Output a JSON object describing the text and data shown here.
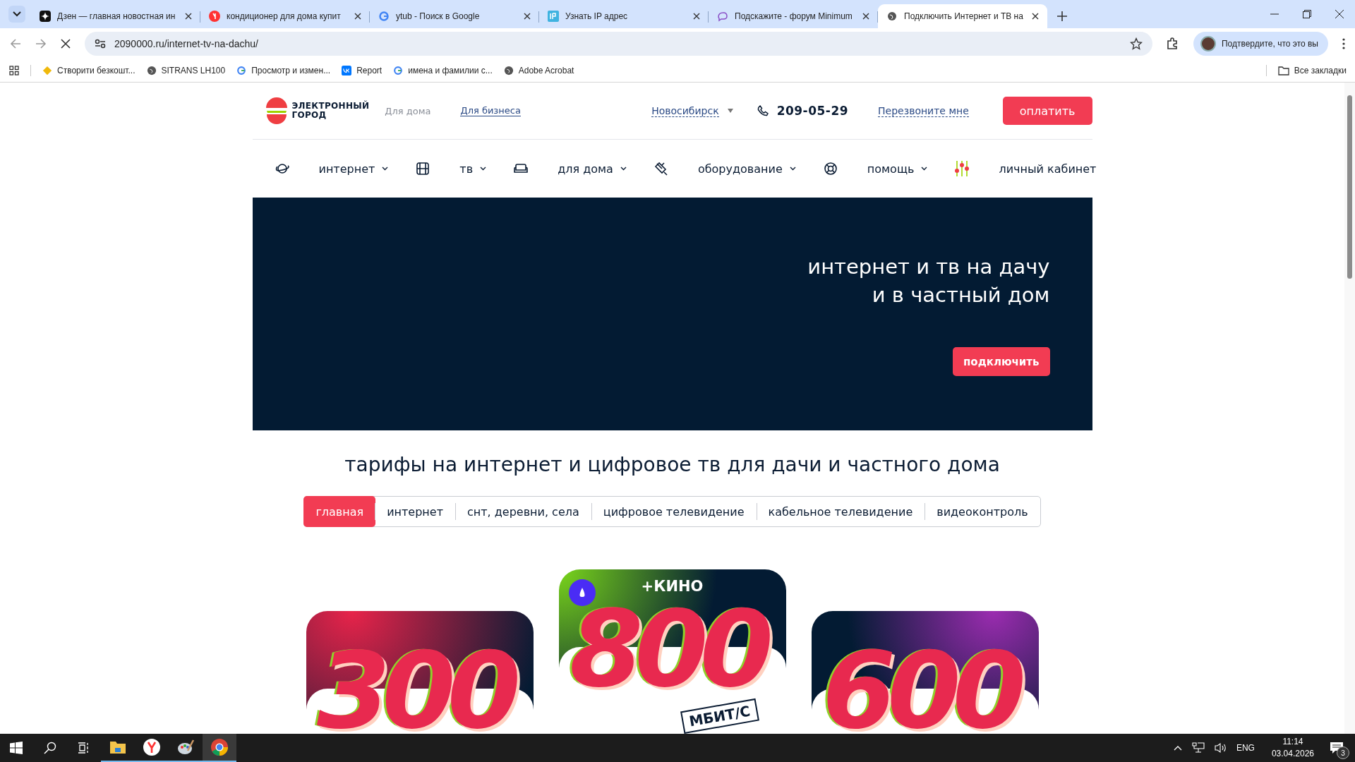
{
  "browser": {
    "tabs": [
      {
        "kind": "dzen",
        "title": "Дзен — главная новостная ин",
        "selected": false
      },
      {
        "kind": "yandex",
        "title": "кондиционер для дома купит",
        "selected": false
      },
      {
        "kind": "google",
        "title": "ytub - Поиск в Google",
        "selected": false
      },
      {
        "kind": "ip",
        "title": "Узнать IP адрес",
        "selected": false
      },
      {
        "kind": "forum",
        "title": "Подскажите - форум Minimum",
        "selected": false
      },
      {
        "kind": "globe",
        "title": "Подключить Интернет и ТВ на",
        "selected": true
      }
    ],
    "url": "2090000.ru/internet-tv-na-dachu/",
    "profile": "Подтвердите, что это вы",
    "bookmarks": [
      {
        "kind": "diamond",
        "label": "Створити безкошт..."
      },
      {
        "kind": "globe",
        "label": "SITRANS LH100"
      },
      {
        "kind": "google",
        "label": "Просмотр и измен..."
      },
      {
        "kind": "vk",
        "label": "Report"
      },
      {
        "kind": "google",
        "label": "имена и фамилии с..."
      },
      {
        "kind": "globe",
        "label": "Adobe Acrobat"
      }
    ],
    "all_bookmarks": "Все закладки"
  },
  "page": {
    "logo": [
      "ЭЛЕКТРОННЫЙ",
      "ГОРОД"
    ],
    "segments": [
      {
        "label": "Для дома",
        "selected": true
      },
      {
        "label": "Для бизнеса",
        "selected": false
      }
    ],
    "city": "Новосибирск",
    "phone": "209-05-29",
    "callback": "Перезвоните мне",
    "pay_button": "оплатить",
    "nav": [
      {
        "kind": "planet",
        "label": "интернет",
        "dropdown": true
      },
      {
        "kind": "film",
        "label": "тв",
        "dropdown": true
      },
      {
        "kind": "sofa",
        "label": "для дома",
        "dropdown": true
      },
      {
        "kind": "satellite",
        "label": "оборудование",
        "dropdown": true
      },
      {
        "kind": "lifebuoy",
        "label": "помощь",
        "dropdown": true
      },
      {
        "kind": "sliders",
        "label": "личный кабинет",
        "dropdown": false
      }
    ],
    "hero": {
      "title": [
        "интернет и тв на дачу",
        "и в частный дом"
      ],
      "button": "подключить"
    },
    "heading": "тарифы на интернет и цифровое тв для дачи и частного дома",
    "filters": [
      {
        "label": "главная",
        "selected": true
      },
      {
        "label": "интернет",
        "selected": false
      },
      {
        "label": "снт, деревни, села",
        "selected": false
      },
      {
        "label": "цифровое телевидение",
        "selected": false
      },
      {
        "label": "кабельное телевидение",
        "selected": false
      },
      {
        "label": "видеоконтроль",
        "selected": false
      }
    ],
    "cards": [
      {
        "speed": "300",
        "featured": false
      },
      {
        "speed": "800",
        "featured": true,
        "extra": "+КИНО",
        "unit": "МБИТ/С"
      },
      {
        "speed": "600",
        "featured": false
      }
    ]
  },
  "taskbar": {
    "apps": [
      {
        "kind": "folder",
        "active": false
      },
      {
        "kind": "yandex",
        "active": false
      },
      {
        "kind": "paint",
        "active": false
      },
      {
        "kind": "chrome",
        "active": true
      }
    ],
    "language": "ENG",
    "time": "11:14",
    "date": "03.04.2026",
    "notifications": "3"
  }
}
